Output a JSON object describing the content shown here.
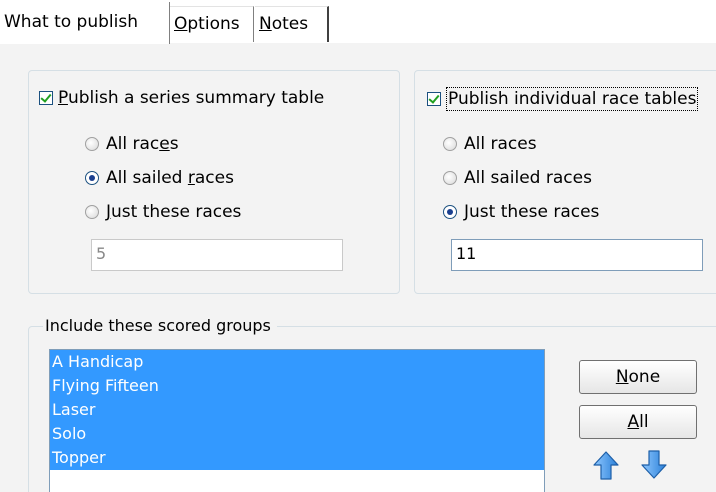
{
  "tabs": [
    {
      "label_pre": "What to publish",
      "label_u": "",
      "label_post": ""
    },
    {
      "label_pre": "",
      "label_u": "O",
      "label_post": "ptions"
    },
    {
      "label_pre": "",
      "label_u": "N",
      "label_post": "otes"
    }
  ],
  "summary_panel": {
    "checkbox_u": "P",
    "checkbox_rest": "ublish a series summary table",
    "checked": true,
    "options": [
      {
        "pre": "All rac",
        "u": "e",
        "post": "s"
      },
      {
        "pre": "All sailed ",
        "u": "r",
        "post": "aces"
      },
      {
        "pre": "",
        "u": "J",
        "post": "ust these races"
      }
    ],
    "selected_index": 1,
    "races_value": "5"
  },
  "race_panel": {
    "checkbox_label": "Publish individual race tables",
    "checked": true,
    "options": [
      {
        "label": "All races"
      },
      {
        "label": "All sailed races"
      },
      {
        "label": "Just these races"
      }
    ],
    "selected_index": 2,
    "races_value": "11"
  },
  "groups_panel": {
    "title": "Include these scored groups",
    "items": [
      "A Handicap",
      "Flying Fifteen",
      "Laser",
      "Solo",
      "Topper"
    ],
    "none_button": {
      "u": "N",
      "rest": "one"
    },
    "all_button": {
      "u": "A",
      "rest": "ll"
    },
    "move_up_icon": "up-arrow-icon",
    "move_down_icon": "down-arrow-icon"
  },
  "colors": {
    "selection": "#3399ff",
    "panel_background": "#f3f3f3",
    "arrow": "#3a8ee6"
  }
}
